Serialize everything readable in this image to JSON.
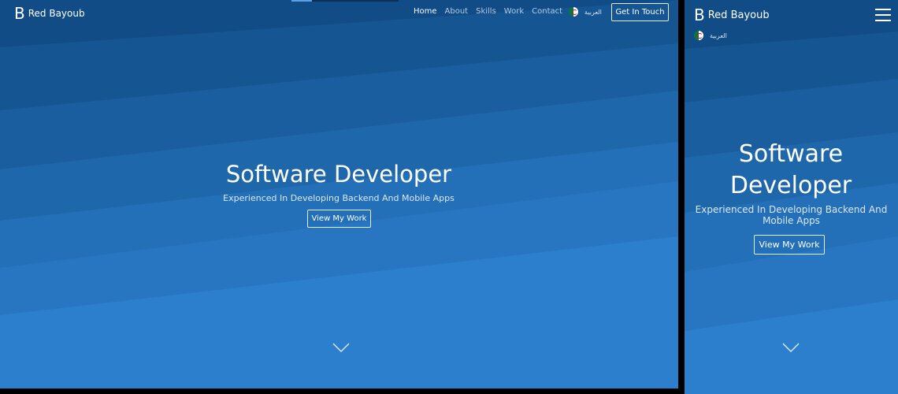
{
  "brand": {
    "mark": "B",
    "name": "Red Bayoub"
  },
  "nav": {
    "items": [
      {
        "label": "Home",
        "active": true
      },
      {
        "label": "About",
        "active": false
      },
      {
        "label": "Skills",
        "active": false
      },
      {
        "label": "Work",
        "active": false
      },
      {
        "label": "Contact",
        "active": false
      }
    ]
  },
  "language": {
    "label": "العربية",
    "flag_icon": "algeria-flag-icon"
  },
  "cta": {
    "label": "Get In Touch"
  },
  "hero": {
    "title": "Software Developer",
    "subtitle": "Experienced In Developing Backend And Mobile Apps",
    "button_label": "View My Work"
  },
  "icons": {
    "scroll_down": "chevron-down-icon",
    "menu": "hamburger-menu-icon"
  },
  "colors": {
    "bg_dark": "#114a82",
    "bg_mid": "#1e66a8",
    "bg_light": "#2e83d2",
    "text": "#ffffff"
  }
}
